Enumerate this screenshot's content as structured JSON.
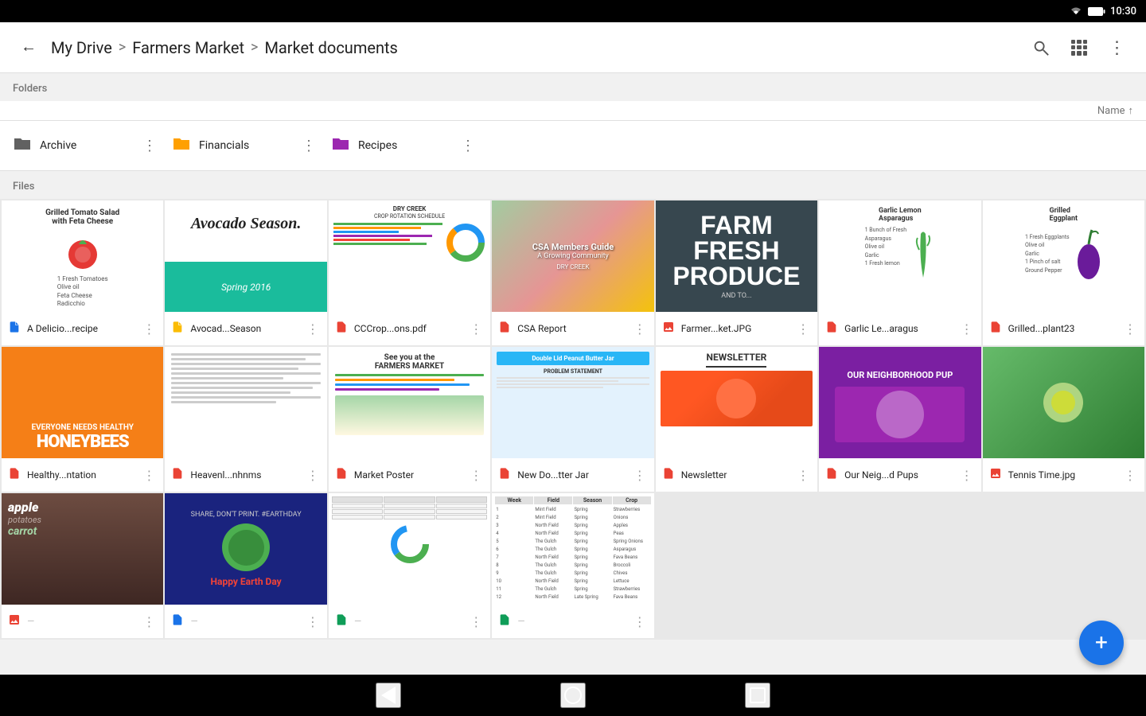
{
  "statusBar": {
    "time": "10:30"
  },
  "topBar": {
    "backLabel": "←",
    "breadcrumb": {
      "root": "My Drive",
      "sep1": ">",
      "mid": "Farmers Market",
      "sep2": ">",
      "current": "Market documents"
    },
    "sortLabel": "Name",
    "sortDirection": "↑"
  },
  "sections": {
    "folders": "Folders",
    "files": "Files"
  },
  "folders": [
    {
      "name": "Archive",
      "color": "gray",
      "icon": "📁"
    },
    {
      "name": "Financials",
      "color": "orange",
      "icon": "📁"
    },
    {
      "name": "Recipes",
      "color": "purple",
      "icon": "📁"
    }
  ],
  "files": [
    {
      "name": "A Delicio...recipe",
      "type": "doc",
      "typeColor": "#1a73e8",
      "thumbType": "tomato"
    },
    {
      "name": "Avocad...Season",
      "type": "doc",
      "typeColor": "#fbbc04",
      "thumbType": "avocado"
    },
    {
      "name": "CCCrop...ons.pdf",
      "type": "pdf",
      "typeColor": "#ea4335",
      "thumbType": "chart"
    },
    {
      "name": "CSA Report",
      "type": "pdf",
      "typeColor": "#ea4335",
      "thumbType": "photo-veg"
    },
    {
      "name": "Farmer...ket.JPG",
      "type": "img",
      "typeColor": "#ea4335",
      "thumbType": "farmfresh"
    },
    {
      "name": "Garlic Le...aragus",
      "type": "pdf",
      "typeColor": "#ea4335",
      "thumbType": "asparagus"
    },
    {
      "name": "Grilled...plant23",
      "type": "pdf",
      "typeColor": "#ea4335",
      "thumbType": "eggplant"
    },
    {
      "name": "Healthy...ntation",
      "type": "pdf",
      "typeColor": "#ea4335",
      "thumbType": "honeybee"
    },
    {
      "name": "Heavenl...nhnms",
      "type": "pdf",
      "typeColor": "#ea4335",
      "thumbType": "article"
    },
    {
      "name": "Market Poster",
      "type": "pdf",
      "typeColor": "#ea4335",
      "thumbType": "market-poster"
    },
    {
      "name": "New Do...tter Jar",
      "type": "pdf",
      "typeColor": "#ea4335",
      "thumbType": "peanut"
    },
    {
      "name": "Newsletter",
      "type": "pdf",
      "typeColor": "#ea4335",
      "thumbType": "newsletter"
    },
    {
      "name": "Our Neig...d Pups",
      "type": "pdf",
      "typeColor": "#ea4335",
      "thumbType": "dogs"
    },
    {
      "name": "Tennis Time.jpg",
      "type": "img",
      "typeColor": "#ea4335",
      "thumbType": "tennis"
    },
    {
      "name": "",
      "type": "img",
      "typeColor": "#ea4335",
      "thumbType": "veggies"
    },
    {
      "name": "",
      "type": "doc",
      "typeColor": "#1a73e8",
      "thumbType": "earth-day"
    },
    {
      "name": "",
      "type": "sheet",
      "typeColor": "#0f9d58",
      "thumbType": "spreadsheet1"
    },
    {
      "name": "",
      "type": "sheet",
      "typeColor": "#0f9d58",
      "thumbType": "spreadsheet2"
    }
  ],
  "fab": {
    "label": "+"
  },
  "nav": {
    "back": "◀",
    "home": "○",
    "recent": "□"
  }
}
